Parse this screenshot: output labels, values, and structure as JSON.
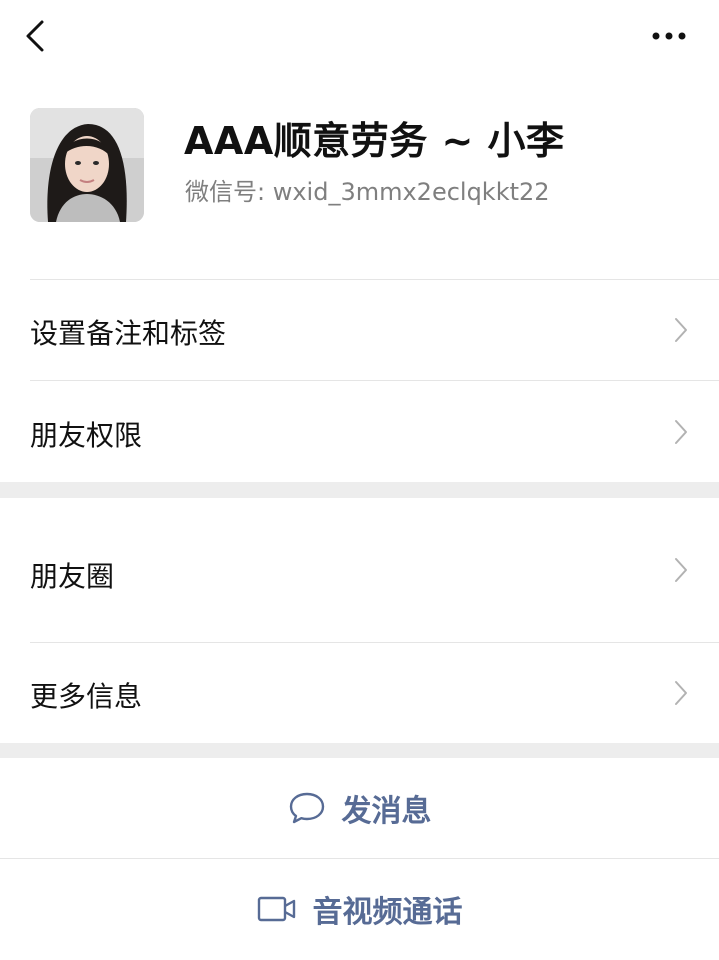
{
  "topbar": {
    "back_icon": "chevron-left-icon",
    "more_icon": "more-horizontal-icon"
  },
  "profile": {
    "name": "AAA顺意劳务 ~ 小李",
    "wechat_id": "微信号:  wxid_3mmx2eclqkkt22"
  },
  "menu_group1": [
    {
      "label": "设置备注和标签"
    },
    {
      "label": "朋友权限"
    }
  ],
  "menu_group2": [
    {
      "label": "朋友圈"
    },
    {
      "label": "更多信息"
    }
  ],
  "actions": {
    "send_message": "发消息",
    "video_call": "音视频通话"
  },
  "colors": {
    "action_text": "#576b95",
    "background": "#ffffff",
    "separator_band": "#ededed"
  }
}
